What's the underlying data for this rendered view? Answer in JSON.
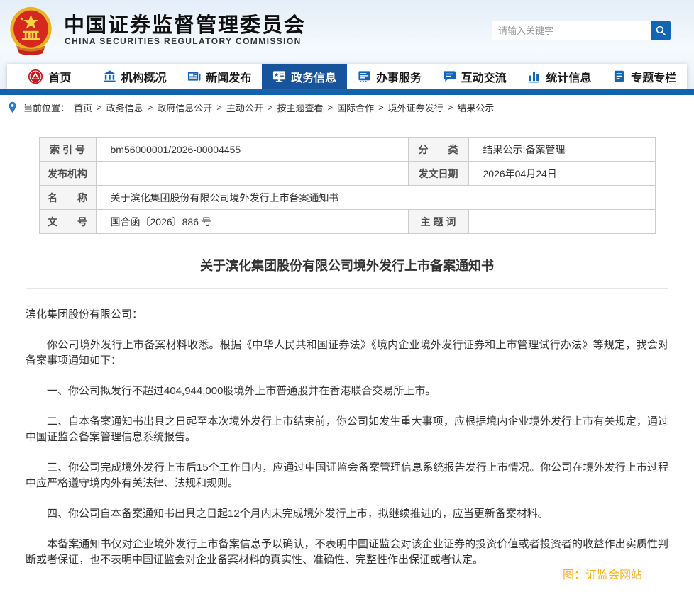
{
  "header": {
    "title": "中国证券监督管理委员会",
    "subtitle": "CHINA SECURITIES REGULATORY COMMISSION",
    "search": {
      "placeholder": "请输入关键字",
      "value": ""
    }
  },
  "nav": {
    "items": [
      {
        "label": "首页",
        "icon": "csrc-logo-icon",
        "active": false
      },
      {
        "label": "机构概况",
        "icon": "bank-icon",
        "active": false
      },
      {
        "label": "新闻发布",
        "icon": "news-icon",
        "active": false
      },
      {
        "label": "政务信息",
        "icon": "monitor-icon",
        "active": true
      },
      {
        "label": "办事服务",
        "icon": "form-icon",
        "active": false
      },
      {
        "label": "互动交流",
        "icon": "chat-icon",
        "active": false
      },
      {
        "label": "统计信息",
        "icon": "bar-chart-icon",
        "active": false
      },
      {
        "label": "专题专栏",
        "icon": "document-icon",
        "active": false
      }
    ]
  },
  "breadcrumb": {
    "prefix": "当前位置：",
    "separator": ">",
    "items": [
      "首页",
      "政务信息",
      "政府信息公开",
      "主动公开",
      "按主题查看",
      "国际合作",
      "境外证券发行",
      "结果公示"
    ]
  },
  "info_table": {
    "index_label": "索 引 号",
    "index_value": "bm56000001/2026-00004455",
    "category_label": "分　　类",
    "category_value": "结果公示;备案管理",
    "agency_label": "发布机构",
    "agency_value": "",
    "date_label": "发文日期",
    "date_value": "2026年04月24日",
    "name_label": "名　　称",
    "name_value": "关于滨化集团股份有限公司境外发行上市备案通知书",
    "docno_label": "文　　号",
    "docno_value": "国合函〔2026〕886 号",
    "keywords_label": "主 题 词",
    "keywords_value": ""
  },
  "document": {
    "title": "关于滨化集团股份有限公司境外发行上市备案通知书",
    "paragraphs": [
      "滨化集团股份有限公司：",
      "你公司境外发行上市备案材料收悉。根据《中华人民共和国证券法》《境内企业境外发行证券和上市管理试行办法》等规定，我会对备案事项通知如下：",
      "一、你公司拟发行不超过404,944,000股境外上市普通股并在香港联合交易所上市。",
      "二、自本备案通知书出具之日起至本次境外发行上市结束前，你公司如发生重大事项，应根据境内企业境外发行上市有关规定，通过中国证监会备案管理信息系统报告。",
      "三、你公司完成境外发行上市后15个工作日内，应通过中国证监会备案管理信息系统报告发行上市情况。你公司在境外发行上市过程中应严格遵守境内外有关法律、法规和规则。",
      "四、你公司自本备案通知书出具之日起12个月内未完成境外发行上市，拟继续推进的，应当更新备案材料。",
      "本备案通知书仅对企业境外发行上市备案信息予以确认，不表明中国证监会对该企业证券的投资价值或者投资者的收益作出实质性判断或者保证，也不表明中国证监会对企业备案材料的真实性、准确性、完整性作出保证或者认定。"
    ],
    "credit": "图：证监会网站"
  },
  "colors": {
    "brand_blue": "#1065b5",
    "nav_active_blue": "#17549b",
    "nav_bar_blue": "#0d64b2",
    "emblem_red": "#d5281e",
    "emblem_gold": "#e8b425",
    "credit_orange": "#fbb01d",
    "table_label_bg": "#f5f5f5"
  }
}
